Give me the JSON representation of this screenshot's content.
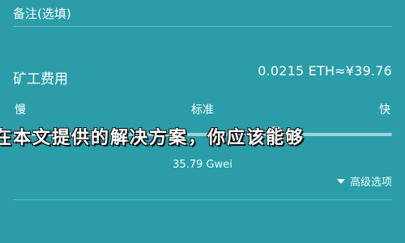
{
  "remark": {
    "label": "备注(选填)"
  },
  "fee": {
    "label": "矿工费用",
    "value": "0.0215 ETH≈¥39.76"
  },
  "speed": {
    "slow_label": "慢",
    "standard_label": "标准",
    "fast_label": "快",
    "gwei_text": "35.79 Gwei",
    "level_fraction": 0.69
  },
  "overlay": {
    "text": "在本文提供的解决方案，你应该能够"
  },
  "advanced": {
    "label": "高级选项"
  },
  "colors": {
    "background": "#2a9da8",
    "text": "#ffffff"
  }
}
